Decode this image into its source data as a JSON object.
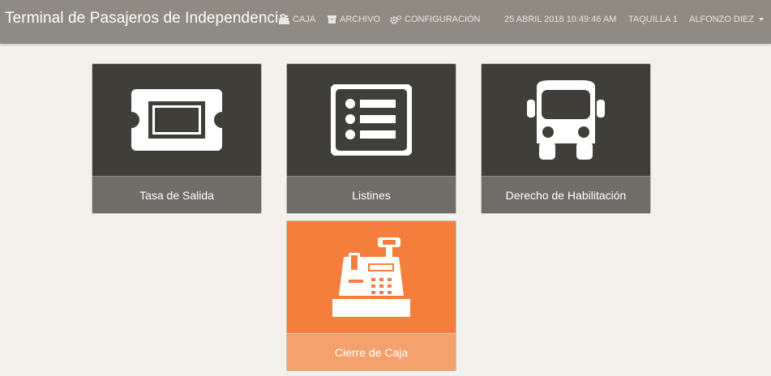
{
  "navbar": {
    "brand": "Terminal de Pasajeros de Independencia",
    "menu": [
      {
        "label": "CAJA",
        "icon": "cash-register-icon"
      },
      {
        "label": "ARCHIVO",
        "icon": "archive-box-icon"
      },
      {
        "label": "CONFIGURACIÓN",
        "icon": "gears-icon"
      }
    ],
    "datetime": "25 ABRIL 2018 10:49:46 AM",
    "station": "TAQUILLA 1",
    "user": "ALFONZO DIEZ"
  },
  "tiles": [
    {
      "label": "Tasa de Salida",
      "icon": "ticket-icon"
    },
    {
      "label": "Listines",
      "icon": "list-icon"
    },
    {
      "label": "Derecho de Habilitación",
      "icon": "bus-icon"
    },
    {
      "label": "Cierre de Caja",
      "icon": "cash-register-icon"
    }
  ],
  "colors": {
    "navbar": "#8f8a82",
    "background": "#f4f1ed",
    "tile_dark": "#3f3e39",
    "tile_label": "#6e6d67",
    "tile_accent": "#f47f3d",
    "tile_accent_label": "#f5a16d"
  }
}
